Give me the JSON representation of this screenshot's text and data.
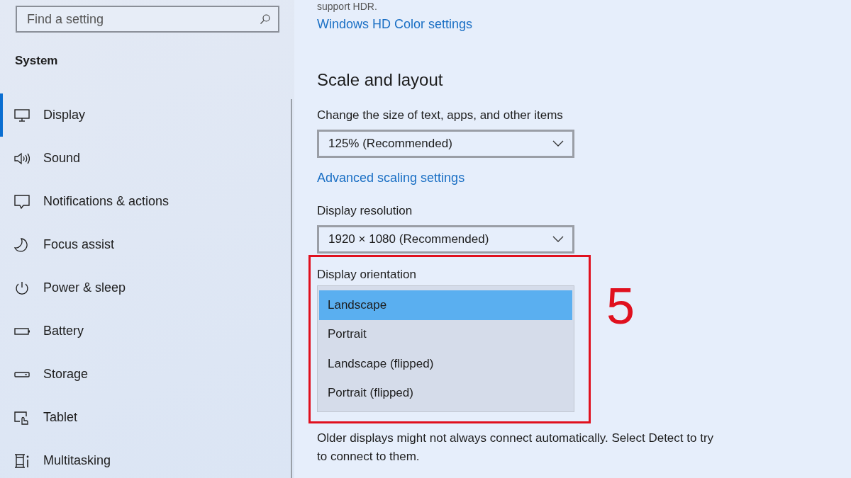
{
  "sidebar": {
    "search": {
      "placeholder": "Find a setting"
    },
    "heading": "System",
    "items": [
      {
        "label": "Display",
        "kind": "monitor",
        "selected": true
      },
      {
        "label": "Sound",
        "kind": "speaker",
        "selected": false
      },
      {
        "label": "Notifications & actions",
        "kind": "message",
        "selected": false
      },
      {
        "label": "Focus assist",
        "kind": "moon",
        "selected": false
      },
      {
        "label": "Power & sleep",
        "kind": "power",
        "selected": false
      },
      {
        "label": "Battery",
        "kind": "battery",
        "selected": false
      },
      {
        "label": "Storage",
        "kind": "drive",
        "selected": false
      },
      {
        "label": "Tablet",
        "kind": "tablet",
        "selected": false
      },
      {
        "label": "Multitasking",
        "kind": "multitask",
        "selected": false
      }
    ]
  },
  "main": {
    "hdr_note": "support HDR.",
    "hdr_link": "Windows HD Color settings",
    "section_title": "Scale and layout",
    "scale": {
      "label": "Change the size of text, apps, and other items",
      "value": "125% (Recommended)"
    },
    "scaling_link": "Advanced scaling settings",
    "resolution": {
      "label": "Display resolution",
      "value": "1920 × 1080 (Recommended)"
    },
    "orientation": {
      "label": "Display orientation",
      "options": [
        {
          "label": "Landscape",
          "selected": true
        },
        {
          "label": "Portrait",
          "selected": false
        },
        {
          "label": "Landscape (flipped)",
          "selected": false
        },
        {
          "label": "Portrait (flipped)",
          "selected": false
        }
      ]
    },
    "note": "Older displays might not always connect automatically. Select Detect to try to connect to them."
  },
  "annotation": {
    "step": "5"
  }
}
